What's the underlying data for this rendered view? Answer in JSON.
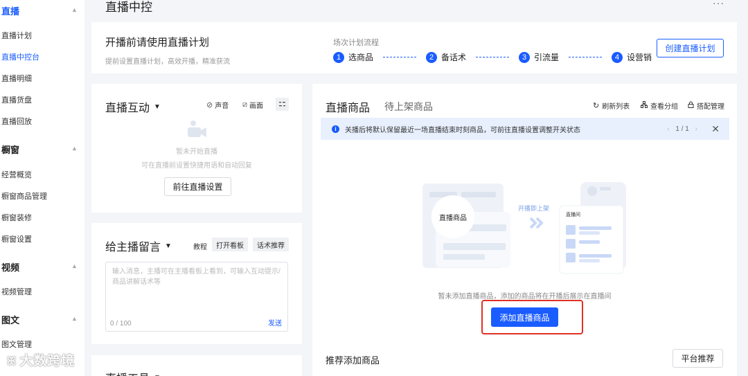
{
  "sidebar": {
    "groups": [
      {
        "label": "直播",
        "items": [
          "直播计划",
          "直播中控台",
          "直播明细",
          "直播货盘",
          "直播回放"
        ]
      },
      {
        "label": "橱窗",
        "items": [
          "经营概览",
          "橱窗商品管理",
          "橱窗装修",
          "橱窗设置"
        ]
      },
      {
        "label": "视频",
        "items": [
          "视频管理"
        ]
      },
      {
        "label": "图文",
        "items": [
          "图文管理"
        ]
      }
    ],
    "active_item": "直播中控台",
    "active_color": "#1a5cff"
  },
  "header": {
    "title": "直播中控",
    "more": "···"
  },
  "plan": {
    "title": "开播前请使用直播计划",
    "subtitle": "提前设置直播计划，高效开播，精准获流",
    "flow_label": "场次计划流程",
    "steps": [
      {
        "num": "1",
        "label": "选商品"
      },
      {
        "num": "2",
        "label": "备话术"
      },
      {
        "num": "3",
        "label": "引流量"
      },
      {
        "num": "4",
        "label": "设营销"
      }
    ],
    "create_button": "创建直播计划"
  },
  "interaction": {
    "title": "直播互动",
    "sound": "声音",
    "screen": "画面",
    "empty_title": "暂未开始直播",
    "empty_desc": "可在直播前设置快捷用语和自动回复",
    "goto_button": "前往直播设置"
  },
  "message": {
    "title": "给主播留言",
    "tutorial": "教程",
    "open_board": "打开看板",
    "script_recommend": "话术推荐",
    "placeholder": "输入消息，主播可在主播看板上看到，可输入互动提示/商品讲解话术等",
    "count": "0 / 100",
    "send": "发送"
  },
  "tools": {
    "title": "直播工具"
  },
  "products": {
    "title": "直播商品",
    "tab2": "待上架商品",
    "refresh": "刷新列表",
    "view_group": "查看分组",
    "combo_manage": "搭配管理",
    "notice": "关播后将默认保留最近一场直播结束时刻商品，可前往直播设置调整开关状态",
    "pager": "1 / 1",
    "illus_badge": "直播商品",
    "illus_arrow_text": "开播即上架",
    "illus_room": "直播间",
    "empty_desc": "暂未添加直播商品，添加的商品将在开播后展示在直播间",
    "add_button": "添加直播商品",
    "recommend_title": "推荐添加商品",
    "platform_button": "平台推荐"
  },
  "watermark": "大数跨境",
  "colors": {
    "accent": "#1a5cff",
    "highlight": "#e03024",
    "notice_bg": "#e8f0fe"
  }
}
